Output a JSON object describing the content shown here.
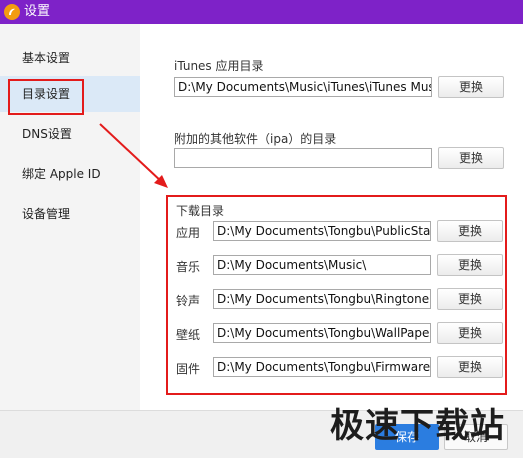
{
  "window": {
    "title": "设置",
    "app_icon": "app-logo-icon"
  },
  "sidebar": {
    "items": [
      {
        "label": "基本设置"
      },
      {
        "label": "目录设置",
        "active": true
      },
      {
        "label": "DNS设置"
      },
      {
        "label": "绑定 Apple ID"
      },
      {
        "label": "设备管理"
      }
    ]
  },
  "itunes": {
    "label": "iTunes 应用目录",
    "value": "D:\\My Documents\\Music\\iTunes\\iTunes Mus",
    "button": "更换"
  },
  "ipa": {
    "label": "附加的其他软件（ipa）的目录",
    "value": "",
    "button": "更换"
  },
  "download": {
    "title": "下载目录",
    "rows": [
      {
        "label": "应用",
        "value": "D:\\My Documents\\Tongbu\\PublicStag",
        "button": "更换"
      },
      {
        "label": "音乐",
        "value": "D:\\My Documents\\Music\\",
        "button": "更换"
      },
      {
        "label": "铃声",
        "value": "D:\\My Documents\\Tongbu\\Ringtone",
        "button": "更换"
      },
      {
        "label": "壁纸",
        "value": "D:\\My Documents\\Tongbu\\WallPape",
        "button": "更换"
      },
      {
        "label": "固件",
        "value": "D:\\My Documents\\Tongbu\\Firmware\\",
        "button": "更换"
      }
    ]
  },
  "footer": {
    "save_label": "保存",
    "cancel_label": "取消"
  },
  "watermark": "极速下载站",
  "colors": {
    "titlebar": "#7e22c8",
    "highlight": "#e31b1b",
    "accent": "#2b7de0"
  }
}
